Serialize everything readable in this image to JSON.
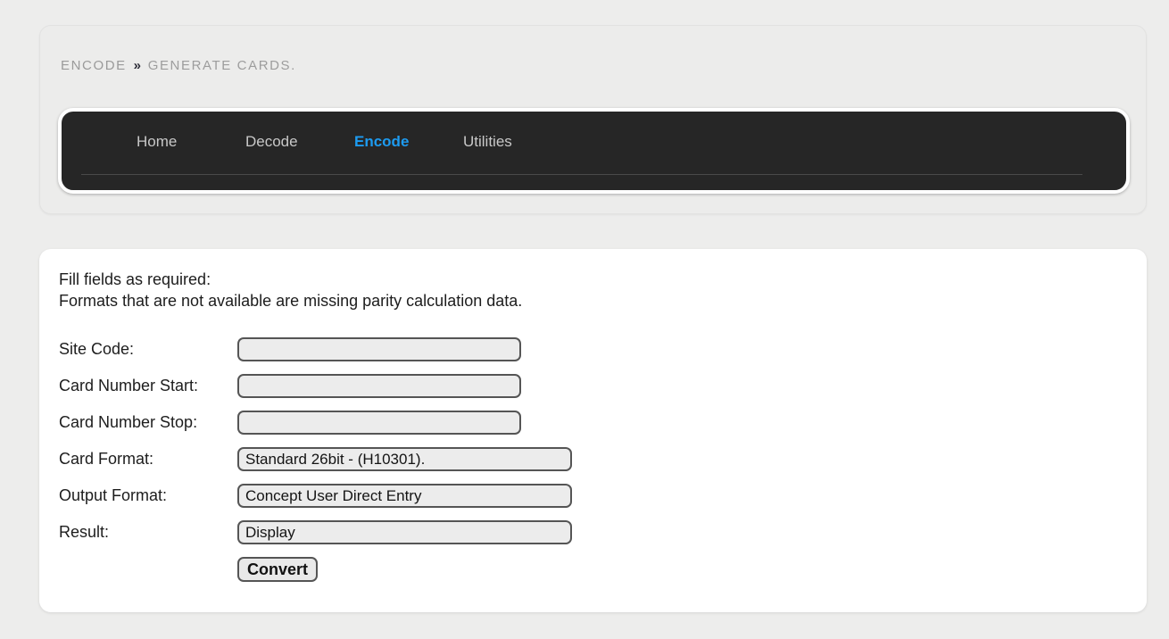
{
  "breadcrumb": {
    "root": "ENCODE",
    "separator": "»",
    "current": "GENERATE CARDS."
  },
  "nav": {
    "items": [
      {
        "label": "Home",
        "active": false
      },
      {
        "label": "Decode",
        "active": false
      },
      {
        "label": "Encode",
        "active": true
      },
      {
        "label": "Utilities",
        "active": false
      }
    ],
    "active_color": "#1d9bf0",
    "inactive_color": "#c8c8c8",
    "background": "#262626"
  },
  "form": {
    "intro_line1": "Fill fields as required:",
    "intro_line2": "Formats that are not available are missing parity calculation data.",
    "fields": [
      {
        "label": "Site Code:",
        "type": "text",
        "value": "",
        "placeholder": ""
      },
      {
        "label": "Card Number Start:",
        "type": "text",
        "value": "",
        "placeholder": ""
      },
      {
        "label": "Card Number Stop:",
        "type": "text",
        "value": "",
        "placeholder": ""
      },
      {
        "label": "Card Format:",
        "type": "select",
        "value": "Standard 26bit - (H10301)."
      },
      {
        "label": "Output Format:",
        "type": "select",
        "value": "Concept User Direct Entry"
      },
      {
        "label": "Result:",
        "type": "select",
        "value": "Display"
      }
    ],
    "submit_label": "Convert"
  },
  "theme": {
    "page_background": "#ededec",
    "card_background": "#ffffff",
    "field_background": "#ececec",
    "field_border": "#555555"
  }
}
